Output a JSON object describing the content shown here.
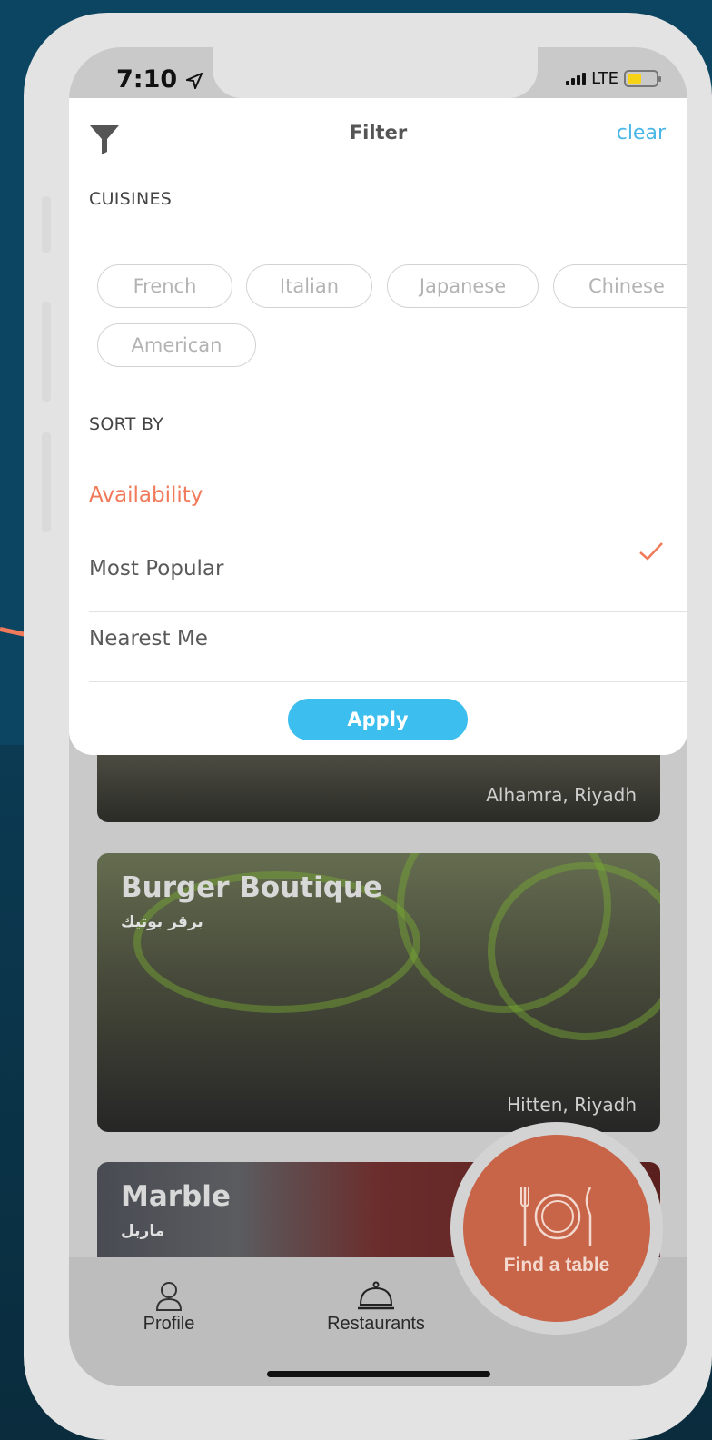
{
  "status_bar": {
    "time": "7:10",
    "network": "LTE"
  },
  "filter": {
    "title": "Filter",
    "clear_label": "clear",
    "cuisines_label": "CUISINES",
    "cuisines": [
      "French",
      "Italian",
      "Japanese",
      "Chinese",
      "American"
    ],
    "sort_label": "SORT BY",
    "sort_options": [
      "Availability",
      "Most Popular",
      "Nearest Me"
    ],
    "selected_sort": "Availability",
    "apply_label": "Apply"
  },
  "restaurants": [
    {
      "name": "",
      "arabic": "",
      "location": "Alhamra, Riyadh"
    },
    {
      "name": "Burger Boutique",
      "arabic": "برقر بوتيك",
      "location": "Hitten, Riyadh"
    },
    {
      "name": "Marble",
      "arabic": "ماربل",
      "location": ""
    }
  ],
  "fab": {
    "label": "Find a table"
  },
  "tabbar": {
    "profile": "Profile",
    "restaurants": "Restaurants"
  },
  "colors": {
    "accent": "#f07a5a",
    "link": "#4ab7e6",
    "apply": "#3cbfee",
    "fab": "#c86549",
    "background": "#0c4561"
  }
}
